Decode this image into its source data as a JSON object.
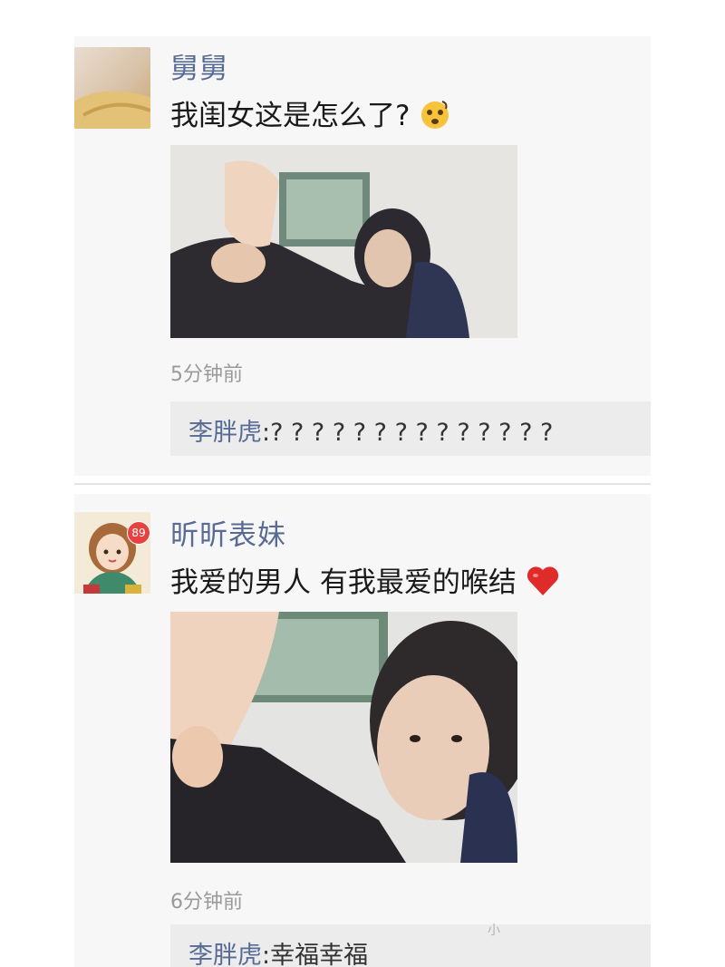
{
  "posts": [
    {
      "author": "舅舅",
      "text": "我闺女这是怎么了?",
      "emoji": "dizzy-face-emoji",
      "time": "5分钟前",
      "comment": {
        "author": "李胖虎",
        "sep": ":",
        "text": "? ? ? ? ? ? ? ? ? ? ? ? ? ?"
      }
    },
    {
      "author": "昕昕表妹",
      "text": "我爱的男人  有我最爱的喉结",
      "emoji": "red-heart-emoji",
      "badge": "89",
      "time": "6分钟前",
      "comment": {
        "author": "李胖虎",
        "sep": ":",
        "text": "幸福幸福"
      }
    }
  ],
  "watermark": "小",
  "colors": {
    "name": "#576b95",
    "card": "#f7f7f7",
    "comment_bg": "#ececec",
    "heart": "#e02b2b"
  }
}
